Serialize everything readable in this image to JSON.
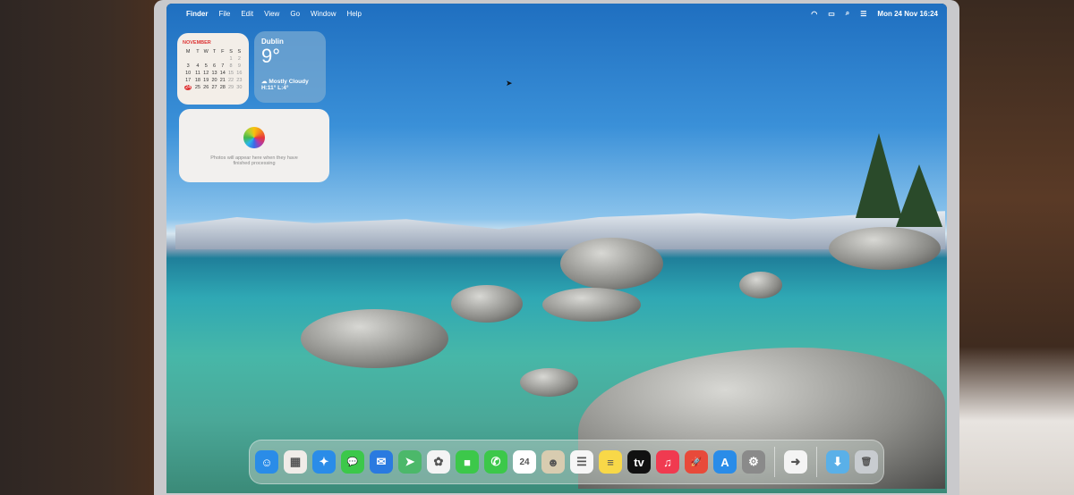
{
  "menubar": {
    "apple": "",
    "items": [
      "Finder",
      "File",
      "Edit",
      "View",
      "Go",
      "Window",
      "Help"
    ],
    "status_icons": [
      "wifi-icon",
      "battery-icon",
      "search-icon",
      "control-center-icon"
    ],
    "clock": "Mon 24 Nov  16:24"
  },
  "calendar_widget": {
    "month": "NOVEMBER",
    "weekdays": [
      "M",
      "T",
      "W",
      "T",
      "F",
      "S",
      "S"
    ],
    "weeks": [
      [
        "",
        "",
        "",
        "",
        "",
        "1",
        "2"
      ],
      [
        "3",
        "4",
        "5",
        "6",
        "7",
        "8",
        "9"
      ],
      [
        "10",
        "11",
        "12",
        "13",
        "14",
        "15",
        "16"
      ],
      [
        "17",
        "18",
        "19",
        "20",
        "21",
        "22",
        "23"
      ],
      [
        "24",
        "25",
        "26",
        "27",
        "28",
        "29",
        "30"
      ]
    ],
    "today": "24"
  },
  "weather_widget": {
    "city": "Dublin",
    "temperature": "9°",
    "condition": "Mostly Cloudy",
    "high_low": "H:11° L:4°"
  },
  "photos_widget": {
    "message": "Photos will appear here when they have finished processing"
  },
  "dock": {
    "apps": [
      {
        "name": "finder",
        "glyph": "☺",
        "color": "#2a8ce8"
      },
      {
        "name": "launchpad",
        "glyph": "▦",
        "color": "#f0ece8"
      },
      {
        "name": "safari",
        "glyph": "✦",
        "color": "#2a8ce8"
      },
      {
        "name": "messages",
        "glyph": "💬",
        "color": "#3cc84a"
      },
      {
        "name": "mail",
        "glyph": "✉",
        "color": "#2a7ae0"
      },
      {
        "name": "maps",
        "glyph": "➤",
        "color": "#4cb86a"
      },
      {
        "name": "photos",
        "glyph": "✿",
        "color": "#f4f4f4"
      },
      {
        "name": "facetime",
        "glyph": "■",
        "color": "#3cc84a"
      },
      {
        "name": "phone",
        "glyph": "✆",
        "color": "#3cc84a"
      },
      {
        "name": "calendar",
        "glyph": "24",
        "color": "#ffffff"
      },
      {
        "name": "contacts",
        "glyph": "☻",
        "color": "#d8ccb0"
      },
      {
        "name": "reminders",
        "glyph": "☰",
        "color": "#f6f6f6"
      },
      {
        "name": "notes",
        "glyph": "≡",
        "color": "#f8d848"
      },
      {
        "name": "apple-tv",
        "glyph": "tv",
        "color": "#111111"
      },
      {
        "name": "music",
        "glyph": "♫",
        "color": "#f03a50"
      },
      {
        "name": "launcher",
        "glyph": "🚀",
        "color": "#e84a3a"
      },
      {
        "name": "app-store",
        "glyph": "A",
        "color": "#2a8ce8"
      },
      {
        "name": "system-settings",
        "glyph": "⚙",
        "color": "#8a8a8a"
      }
    ],
    "recent": [
      {
        "name": "migration",
        "glyph": "➜",
        "color": "#f4f4f4"
      }
    ],
    "right": [
      {
        "name": "downloads-folder",
        "glyph": "⬇",
        "color": "#5ab0e8"
      },
      {
        "name": "trash",
        "glyph": "🗑",
        "color": "#c8ccd0"
      }
    ]
  }
}
